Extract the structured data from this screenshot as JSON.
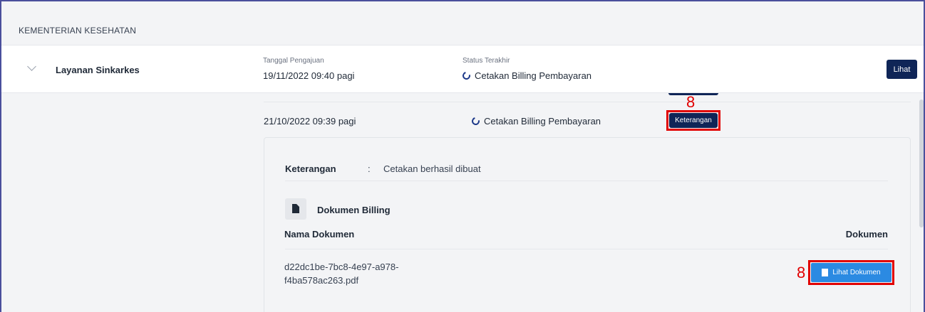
{
  "header": {
    "org_name": "KEMENTERIAN KESEHATAN"
  },
  "service": {
    "name": "Layanan Sinkarkes",
    "submitted_label": "Tanggal Pengajuan",
    "submitted_value": "19/11/2022 09:40 pagi",
    "status_label": "Status Terakhir",
    "status_value": "Cetakan Billing Pembayaran",
    "view_button": "Lihat"
  },
  "history": {
    "date": "21/10/2022 09:39 pagi",
    "status": "Cetakan Billing Pembayaran",
    "info_button": "Keterangan",
    "annotation_number": "8"
  },
  "detail": {
    "note_label": "Keterangan",
    "note_separator": ":",
    "note_value": "Cetakan berhasil dibuat",
    "section_title": "Dokumen Billing",
    "col_name": "Nama Dokumen",
    "col_doc": "Dokumen",
    "file_name_line1": "d22dc1be-7bc8-4e97-a978-",
    "file_name_line2": "f4ba578ac263.pdf",
    "view_doc_button": "Lihat Dokumen",
    "annotation_number": "8"
  },
  "colors": {
    "primary_dark": "#0f2557",
    "primary_blue": "#2b8ae2",
    "annotation_red": "#e10000",
    "frame_border": "#4a4f9c"
  },
  "icons": {
    "expand": "chevron-down-icon",
    "status": "loading-ring-icon",
    "document": "document-icon",
    "file": "file-icon"
  }
}
